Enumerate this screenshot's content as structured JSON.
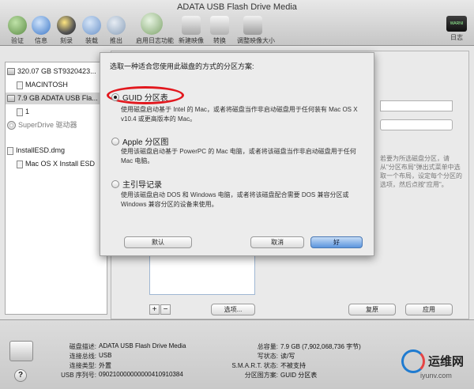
{
  "window": {
    "title": "ADATA USB Flash Drive Media"
  },
  "toolbar": {
    "items": [
      {
        "label": "验证",
        "icon": "verify-icon"
      },
      {
        "label": "信息",
        "icon": "info-icon"
      },
      {
        "label": "刻录",
        "icon": "burn-icon"
      },
      {
        "label": "装载",
        "icon": "mount-icon"
      },
      {
        "label": "推出",
        "icon": "eject-icon"
      },
      {
        "label": "启用日志功能",
        "icon": "enable-journaling-icon"
      },
      {
        "label": "新建映像",
        "icon": "new-image-icon"
      },
      {
        "label": "转换",
        "icon": "convert-icon"
      },
      {
        "label": "调整映像大小",
        "icon": "resize-image-icon"
      }
    ],
    "log_label": "日志",
    "log_icon_text": "WARNI"
  },
  "sidebar": {
    "items": [
      {
        "label": "320.07 GB ST9320423...",
        "type": "disk"
      },
      {
        "label": "MACINTOSH",
        "type": "volume"
      },
      {
        "label": "7.9 GB ADATA USB Fla...",
        "type": "disk",
        "selected": true
      },
      {
        "label": "1",
        "type": "volume"
      },
      {
        "label": "SuperDrive 驱动器",
        "type": "optical"
      },
      {
        "label": "InstallESD.dmg",
        "type": "image"
      },
      {
        "label": "Mac OS X Install ESD",
        "type": "volume"
      }
    ]
  },
  "background_panel": {
    "partition_info_hint": "若要为所选磁盘分区，请从\"分区布局\"弹出式菜单中选取一个布局，设定每个分区的选项，然后点按\"应用\"。",
    "options_button": "选项...",
    "revert_button": "复原",
    "apply_button": "应用",
    "add_button": "+",
    "remove_button": "−"
  },
  "sheet": {
    "title": "选取一种适合您使用此磁盘的方式的分区方案:",
    "options": [
      {
        "label": "GUID 分区表",
        "selected": true,
        "description": "使用磁盘启动基于 Intel 的 Mac，或者将磁盘当作非启动磁盘用于任何装有 Mac OS X v10.4 或更高版本的 Mac。"
      },
      {
        "label": "Apple 分区图",
        "selected": false,
        "description": "使用该磁盘启动基于 PowerPC 的 Mac 电脑，或者将该磁盘当作非启动磁盘用于任何 Mac 电脑。"
      },
      {
        "label": "主引导记录",
        "selected": false,
        "description": "使用该磁盘启动 DOS 和 Windows 电脑，或者将该磁盘配合需要 DOS 兼容分区或 Windows 兼容分区的设备来使用。"
      }
    ],
    "default_button": "默认",
    "cancel_button": "取消",
    "ok_button": "好"
  },
  "footer": {
    "left": [
      {
        "key": "磁盘描述:",
        "value": "ADATA USB Flash Drive Media"
      },
      {
        "key": "连接总线:",
        "value": "USB"
      },
      {
        "key": "连接类型:",
        "value": "外置"
      },
      {
        "key": "USB 序列号:",
        "value": "090210000000000410910384"
      }
    ],
    "right": [
      {
        "key": "总容量:",
        "value": "7.9 GB (7,902,068,736 字节)"
      },
      {
        "key": "写状态:",
        "value": "读/写"
      },
      {
        "key": "S.M.A.R.T. 状态:",
        "value": "不被支持"
      },
      {
        "key": "分区图方案:",
        "value": "GUID 分区表"
      }
    ],
    "help_label": "?"
  },
  "watermark": {
    "title": "运维网",
    "url": "iyunv.com"
  },
  "colors": {
    "highlight_ring": "#e2181e",
    "default_button": "#5b95dd"
  }
}
